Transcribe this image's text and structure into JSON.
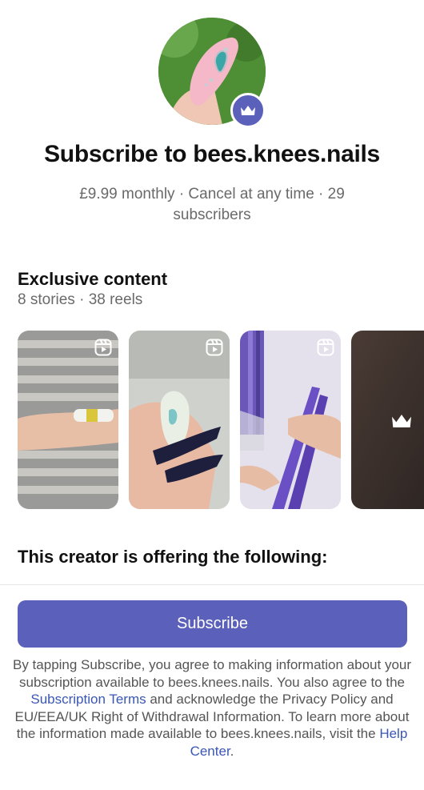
{
  "profile": {
    "avatar_alt": "bees.knees.nails profile photo",
    "badge_icon": "crown-icon"
  },
  "header": {
    "title": "Subscribe to bees.knees.nails",
    "subtitle_line1": "£9.99 monthly · Cancel at any time · 29",
    "subtitle_line2": "subscribers"
  },
  "exclusive": {
    "title": "Exclusive content",
    "summary": "8 stories · 38 reels"
  },
  "offer": {
    "title": "This creator is offering the following:"
  },
  "subscribe_button": {
    "label": "Subscribe"
  },
  "legal": {
    "part1": "By tapping Subscribe, you agree to making information about your subscription available to bees.knees.nails. You also agree to the ",
    "link1": "Subscription Terms",
    "part2": " and acknowledge the Privacy Policy and EU/EEA/UK Right of Withdrawal Information. To learn more about the information made available to bees.knees.nails, visit the ",
    "link2": "Help Center",
    "part3": "."
  },
  "colors": {
    "accent": "#5b60ba",
    "link": "#3a57b4",
    "muted_text": "#6a6a6a"
  }
}
